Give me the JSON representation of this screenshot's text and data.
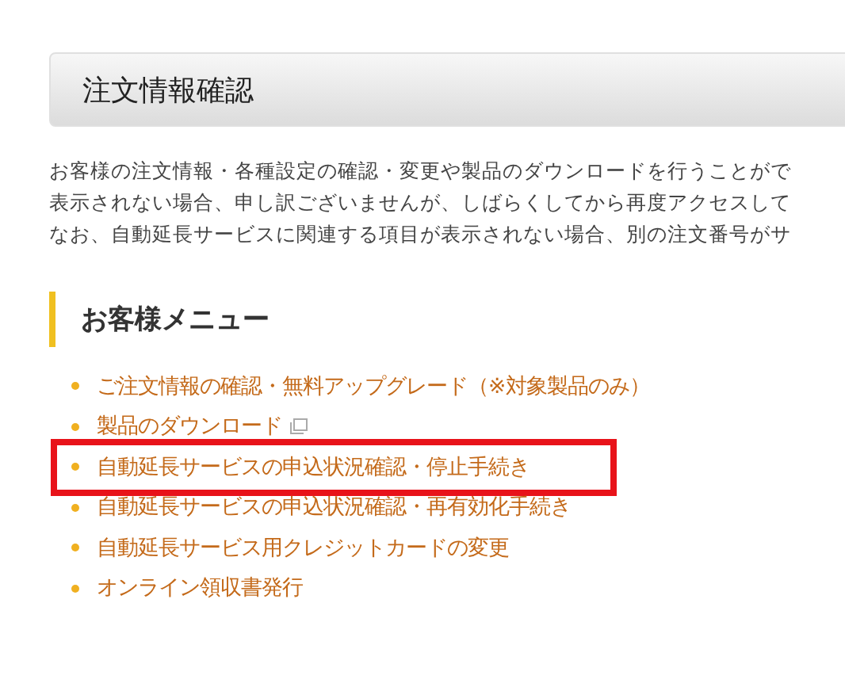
{
  "page_title": "注文情報確認",
  "intro_lines": [
    "お客様の注文情報・各種設定の確認・変更や製品のダウンロードを行うことがで",
    "表示されない場合、申し訳ございませんが、しばらくしてから再度アクセスして",
    "なお、自動延長サービスに関連する項目が表示されない場合、別の注文番号がサ"
  ],
  "menu": {
    "heading": "お客様メニュー",
    "items": [
      {
        "label": "ご注文情報の確認・無料アップグレード（※対象製品のみ）",
        "external": false,
        "highlighted": false
      },
      {
        "label": "製品のダウンロード",
        "external": true,
        "highlighted": false
      },
      {
        "label": "自動延長サービスの申込状況確認・停止手続き",
        "external": false,
        "highlighted": true
      },
      {
        "label": "自動延長サービスの申込状況確認・再有効化手続き",
        "external": false,
        "highlighted": false
      },
      {
        "label": "自動延長サービス用クレジットカードの変更",
        "external": false,
        "highlighted": false
      },
      {
        "label": "オンライン領収書発行",
        "external": false,
        "highlighted": false
      }
    ]
  }
}
